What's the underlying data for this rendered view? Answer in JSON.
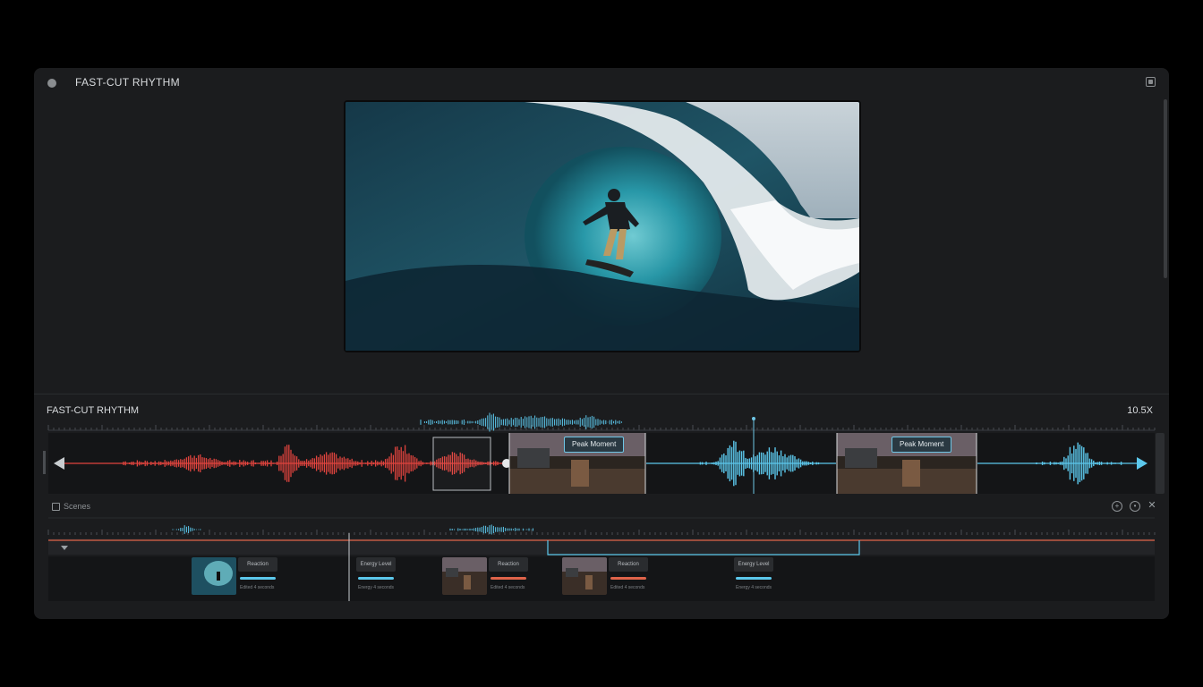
{
  "window": {
    "title": "FAST-CUT RHYTHM"
  },
  "timeline": {
    "title": "FAST-CUT RHYTHM",
    "zoom": "10.5X",
    "peak_labels": [
      "Peak Moment",
      "Peak Moment"
    ]
  },
  "scenes": {
    "label": "Scenes",
    "cards": [
      {
        "label": "Reaction",
        "sub": "Edited 4 seconds",
        "bar_color": "#5cc8ec"
      },
      {
        "label": "Energy Level",
        "sub": "Energy 4 seconds",
        "bar_color": "#5cc8ec"
      },
      {
        "label": "Reaction",
        "sub": "Edited 4 seconds",
        "bar_color": "#e0644a"
      },
      {
        "label": "Reaction",
        "sub": "Edited 4 seconds",
        "bar_color": "#e0644a"
      },
      {
        "label": "Energy Level",
        "sub": "Energy 4 seconds",
        "bar_color": "#5cc8ec"
      }
    ]
  },
  "colors": {
    "accent_blue": "#5cc8ec",
    "accent_red": "#e0443e",
    "accent_orange": "#e0644a",
    "panel": "#1b1c1e"
  },
  "icons": {
    "window_close": "circle-icon",
    "maximize": "square-icon",
    "scenes": "film-icon",
    "add": "plus-circle-icon",
    "settings": "gear-icon",
    "close": "close-icon",
    "collapse": "chevron-down-icon",
    "rewind": "play-left-icon",
    "forward": "play-right-icon"
  }
}
